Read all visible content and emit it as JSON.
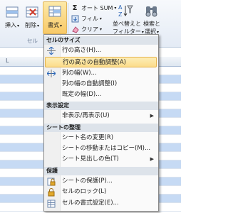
{
  "ribbon": {
    "insert_label": "挿入",
    "delete_label": "削除",
    "format_label": "書式",
    "autosum_label": "オート SUM",
    "fill_label": "フィル",
    "clear_label": "クリア",
    "sort_label_1": "並べ替えと",
    "sort_label_2": "フィルター",
    "find_label_1": "検索と",
    "find_label_2": "選択",
    "cell_group_label": "セル",
    "sigma": "Σ",
    "dropdown_arrow": "▾",
    "icons": [
      "insert-icon",
      "delete-icon",
      "format-icon",
      "autosum-icon",
      "fill-icon",
      "clear-icon",
      "sort-filter-icon",
      "find-select-icon"
    ]
  },
  "sheet": {
    "column_header": "L"
  },
  "menu": {
    "sections": {
      "cell_size": "セルのサイズ",
      "visibility": "表示設定",
      "organize": "シートの整理",
      "protection": "保護"
    },
    "items": {
      "row_height": "行の高さ(H)...",
      "autofit_row": "行の高さの自動調整(A)",
      "col_width": "列の幅(W)...",
      "autofit_col": "列の幅の自動調整(I)",
      "default_width": "既定の幅(D)...",
      "hide_unhide": "非表示/再表示(U)",
      "rename_sheet": "シート名の変更(R)",
      "move_copy_sheet": "シートの移動またはコピー(M)...",
      "tab_color": "シート見出しの色(T)",
      "protect_sheet": "シートの保護(P)...",
      "lock_cell": "セルのロック(L)",
      "format_cells": "セルの書式設定(E)..."
    },
    "submenu_arrow": "▶",
    "active_item": "autofit_row"
  },
  "colors": {
    "accent": "#fbdc8a",
    "row_highlight": "#c6daf4"
  }
}
